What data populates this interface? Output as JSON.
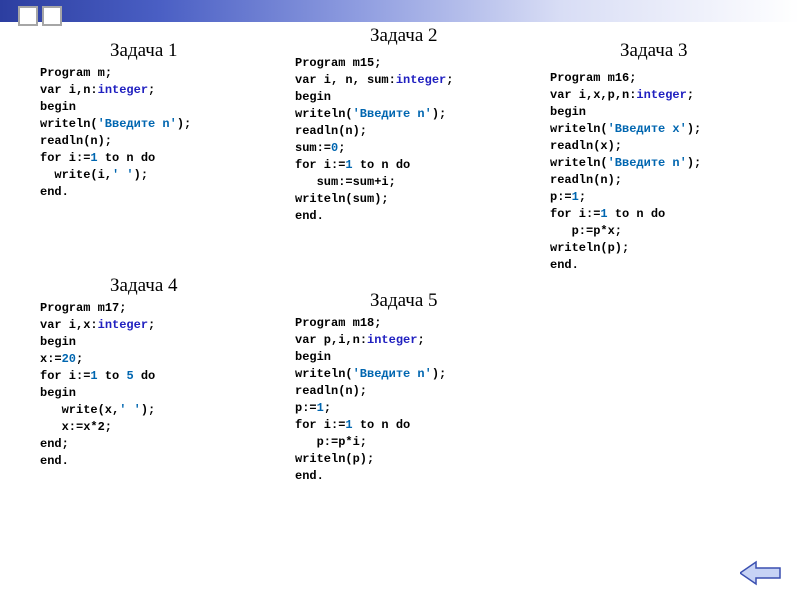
{
  "titles": {
    "t1": "Задача 1",
    "t2": "Задача 2",
    "t3": "Задача 3",
    "t4": "Задача 4",
    "t5": "Задача 5"
  },
  "code": {
    "t1": {
      "l1a": "Program",
      "l1b": " m;",
      "l2a": "var",
      "l2b": " i,n:",
      "l2c": "integer",
      "l2d": ";",
      "l3": "begin",
      "l4a": "writeln(",
      "l4b": "'Введите n'",
      "l4c": ");",
      "l5": "readln(n);",
      "l6a": "for",
      "l6b": " i:=",
      "l6c": "1",
      "l6d": " to",
      "l6e": " n ",
      "l6f": "do",
      "l7a": "  write(i,",
      "l7b": "' '",
      "l7c": ");",
      "l8": "end."
    },
    "t2": {
      "l1a": "Program",
      "l1b": " m15;",
      "l2a": "var",
      "l2b": " i, n, sum:",
      "l2c": "integer",
      "l2d": ";",
      "l3": "begin",
      "l4a": "writeln(",
      "l4b": "'Введите n'",
      "l4c": ");",
      "l5": "readln(n);",
      "l6a": "sum:=",
      "l6b": "0",
      "l6c": ";",
      "l7a": "for",
      "l7b": " i:=",
      "l7c": "1",
      "l7d": " to",
      "l7e": " n ",
      "l7f": "do",
      "l8": "   sum:=sum+i;",
      "l9": "writeln(sum);",
      "l10": "end."
    },
    "t3": {
      "l1a": "Program",
      "l1b": " m16;",
      "l2a": "var",
      "l2b": " i,x,p,n:",
      "l2c": "integer",
      "l2d": ";",
      "l3": "begin",
      "l4a": "writeln(",
      "l4b": "'Введите x'",
      "l4c": ");",
      "l5": "readln(x);",
      "l6a": "writeln(",
      "l6b": "'Введите n'",
      "l6c": ");",
      "l7": "readln(n);",
      "l8a": "p:=",
      "l8b": "1",
      "l8c": ";",
      "l9a": "for",
      "l9b": " i:=",
      "l9c": "1",
      "l9d": " to",
      "l9e": " n ",
      "l9f": "do",
      "l10": "   p:=p*x;",
      "l11": "writeln(p);",
      "l12": "end."
    },
    "t4": {
      "l1a": "Program",
      "l1b": " m17;",
      "l2a": "var",
      "l2b": " i,x:",
      "l2c": "integer",
      "l2d": ";",
      "l3": "begin",
      "l4a": "x:=",
      "l4b": "20",
      "l4c": ";",
      "l5a": "for",
      "l5b": " i:=",
      "l5c": "1",
      "l5d": " to ",
      "l5e": "5",
      "l5f": " do",
      "l6": "begin",
      "l7a": "   write(x,",
      "l7b": "' '",
      "l7c": ");",
      "l8": "   x:=x*2;",
      "l9": "end;",
      "l10": "end."
    },
    "t5": {
      "l1a": "Program",
      "l1b": " m18;",
      "l2a": "var",
      "l2b": " p,i,n:",
      "l2c": "integer",
      "l2d": ";",
      "l3": "begin",
      "l4a": "writeln(",
      "l4b": "'Введите n'",
      "l4c": ");",
      "l5": "readln(n);",
      "l6a": "p:=",
      "l6b": "1",
      "l6c": ";",
      "l7a": "for",
      "l7b": " i:=",
      "l7c": "1",
      "l7d": " to",
      "l7e": " n ",
      "l7f": "do",
      "l8": "   p:=p*i;",
      "l9": "writeln(p);",
      "l10": "end."
    }
  }
}
